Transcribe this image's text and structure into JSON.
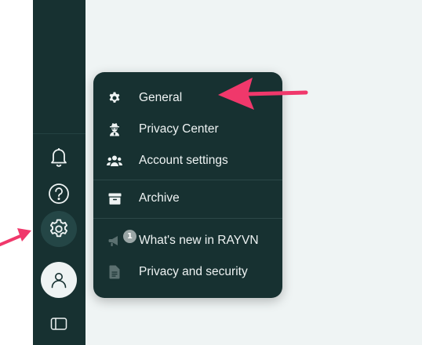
{
  "sidebar": {
    "items": [
      {
        "name": "notifications",
        "icon": "bell-icon"
      },
      {
        "name": "help",
        "icon": "help-circle-icon"
      },
      {
        "name": "settings",
        "icon": "gear-icon",
        "active": true
      },
      {
        "name": "profile",
        "icon": "user-icon"
      },
      {
        "name": "toggle-sidebar",
        "icon": "sidebar-panel-icon"
      }
    ]
  },
  "settings_menu": {
    "items": [
      {
        "label": "General",
        "icon": "gear-icon"
      },
      {
        "label": "Privacy Center",
        "icon": "spy-agent-icon"
      },
      {
        "label": "Account settings",
        "icon": "users-icon"
      },
      {
        "label": "Archive",
        "icon": "archive-box-icon"
      },
      {
        "label": "What's new in RAYVN",
        "icon": "megaphone-icon",
        "badge": "1"
      },
      {
        "label": "Privacy and security",
        "icon": "document-icon"
      }
    ]
  },
  "annotations": {
    "arrow_color": "#f0386b"
  },
  "colors": {
    "sidebar_bg": "#173131",
    "main_bg": "#eff4f4",
    "menu_text": "#eef3f3",
    "icon_color": "#eef3f3"
  }
}
